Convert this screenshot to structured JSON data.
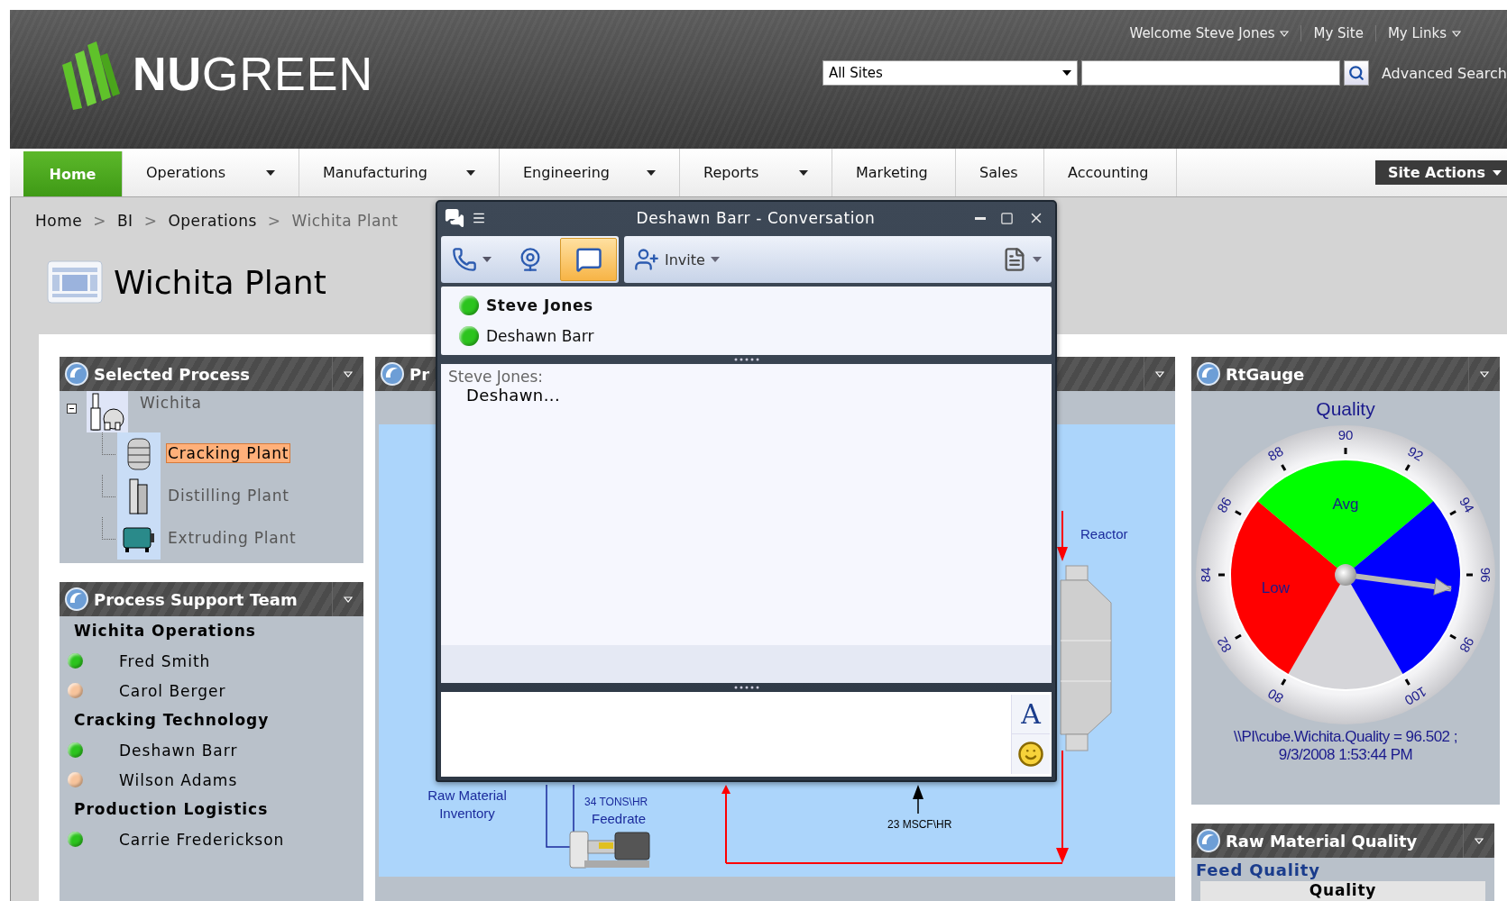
{
  "header": {
    "logo": "**NU**GREEN",
    "top_links": [
      {
        "label": "Welcome Steve Jones",
        "has_menu": true
      },
      {
        "label": "My Site",
        "has_menu": false
      },
      {
        "label": "My Links",
        "has_menu": true
      }
    ],
    "search": {
      "scope": "All Sites",
      "advanced_link": "Advanced Search"
    }
  },
  "nav": {
    "tabs": [
      {
        "label": "Home",
        "selected": true,
        "has_menu": false
      },
      {
        "label": "Operations",
        "selected": false,
        "has_menu": true
      },
      {
        "label": "Manufacturing",
        "selected": false,
        "has_menu": true
      },
      {
        "label": "Engineering",
        "selected": false,
        "has_menu": true
      },
      {
        "label": "Reports",
        "selected": false,
        "has_menu": true
      },
      {
        "label": "Marketing",
        "selected": false,
        "has_menu": false
      },
      {
        "label": "Sales",
        "selected": false,
        "has_menu": false
      },
      {
        "label": "Accounting",
        "selected": false,
        "has_menu": false
      }
    ],
    "site_actions": "Site Actions"
  },
  "breadcrumb": [
    {
      "label": "Home",
      "current": false
    },
    {
      "separator": ">",
      "label": "BI",
      "current": false
    },
    {
      "separator": ">",
      "label": "Operations",
      "current": false
    },
    {
      "separator": ">",
      "label": "Wichita Plant",
      "current": true
    }
  ],
  "page_title": "Wichita Plant",
  "selected_process": {
    "title": "Selected Process",
    "tree": [
      {
        "label": "Wichita",
        "kind": "site",
        "expanded": true,
        "selected": false,
        "children": [
          {
            "label": "Cracking Plant",
            "kind": "tank",
            "selected": true
          },
          {
            "label": "Distilling Plant",
            "kind": "column",
            "selected": false
          },
          {
            "label": "Extruding Plant",
            "kind": "extruder",
            "selected": false
          }
        ]
      }
    ]
  },
  "support_team": {
    "title": "Process Support Team",
    "groups": [
      {
        "name": "Wichita Operations",
        "members": [
          {
            "name": "Fred Smith",
            "color": "#2cc41e"
          },
          {
            "name": "Carol Berger",
            "color": "#f7c49c"
          }
        ]
      },
      {
        "name": "Cracking Technology",
        "members": [
          {
            "name": "Deshawn Barr",
            "color": "#2cc41e"
          },
          {
            "name": "Wilson Adams",
            "color": "#f7c49c"
          }
        ]
      },
      {
        "name": "Production Logistics",
        "members": [
          {
            "name": "Carrie Frederickson",
            "color": "#2cc41e"
          }
        ]
      }
    ]
  },
  "process_panel": {
    "title": "Pr",
    "diagram": {
      "reactor_label": "Reactor",
      "inventory_label": "Raw Material Inventory",
      "feed_rate": "34 TONS\\HR",
      "feed_label": "Feedrate",
      "gas_rate": "23 MSCF\\HR"
    }
  },
  "gauge_panel": {
    "title": "RtGauge",
    "gauge_title": "Quality",
    "ticks": [
      "80",
      "82",
      "84",
      "86",
      "88",
      "90",
      "92",
      "94",
      "96",
      "98",
      "100"
    ],
    "segments": [
      {
        "label": "Low",
        "color": "#ff0000"
      },
      {
        "label": "Avg",
        "color": "#00ff00"
      },
      {
        "color": "#0000ff"
      }
    ],
    "needle": {
      "level": 0.825
    },
    "reading": "\\\\PI\\cube.Wichita.Quality = 96.502 ;",
    "timestamp": "9/3/2008 1:53:44 PM"
  },
  "raw_material_panel": {
    "title": "Raw Material Quality",
    "section": "Feed Quality",
    "table_header": "Quality"
  },
  "chat": {
    "title": "Deshawn Barr - Conversation",
    "toolbar": [
      {
        "kind": "call",
        "selected": false
      },
      {
        "kind": "video",
        "selected": false
      },
      {
        "kind": "im",
        "selected": true
      }
    ],
    "invite": "Invite",
    "participants": [
      {
        "name": "Steve Jones",
        "is_self": true,
        "color": "#2cc41e"
      },
      {
        "name": "Deshawn Barr",
        "is_self": false,
        "color": "#2cc41e"
      }
    ],
    "messages": [
      {
        "sender": "Steve Jones:",
        "text": "Deshawn..."
      }
    ],
    "font_button": "A"
  }
}
